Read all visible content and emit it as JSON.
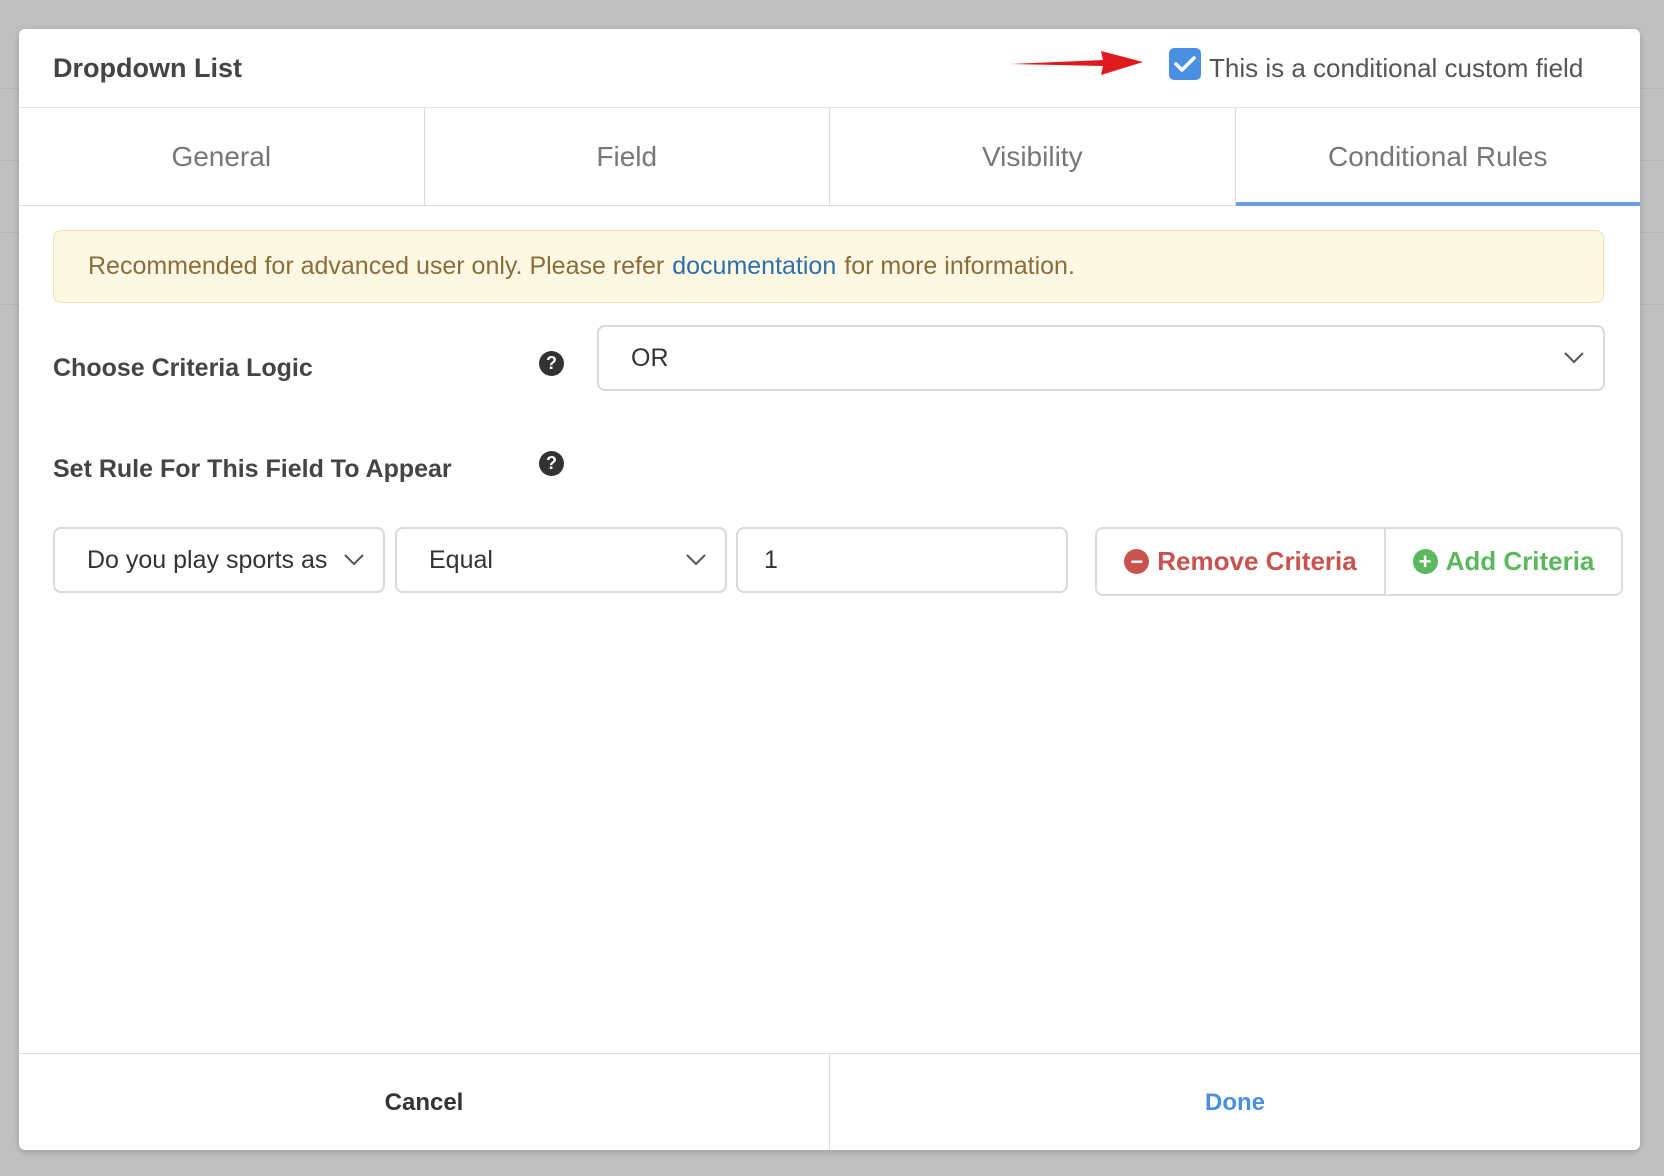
{
  "modal": {
    "title": "Dropdown List",
    "conditional_checkbox": {
      "checked": true,
      "label": "This is a conditional custom field"
    }
  },
  "tabs": [
    {
      "label": "General",
      "active": false
    },
    {
      "label": "Field",
      "active": false
    },
    {
      "label": "Visibility",
      "active": false
    },
    {
      "label": "Conditional Rules",
      "active": true
    }
  ],
  "alert": {
    "text_before": "Recommended for advanced user only. Please refer",
    "link_text": "documentation",
    "text_after": "for more information."
  },
  "criteria_logic": {
    "label": "Choose Criteria Logic",
    "selected": "OR"
  },
  "rule": {
    "label": "Set Rule For This Field To Appear",
    "field_select": "Do you play sports as",
    "operator_select": "Equal",
    "value": "1",
    "remove_label": "Remove Criteria",
    "add_label": "Add Criteria"
  },
  "footer": {
    "cancel_label": "Cancel",
    "done_label": "Done"
  },
  "colors": {
    "accent": "#4a90e2",
    "danger": "#c9534f",
    "success": "#5cb85c",
    "warning_bg": "#fcf8e3",
    "annotation_arrow": "#e0191c"
  },
  "icons": {
    "help": "question-circle-icon",
    "remove": "minus-circle-icon",
    "add": "plus-circle-icon",
    "dropdown": "chevron-down-icon",
    "annotation": "red-arrow"
  }
}
